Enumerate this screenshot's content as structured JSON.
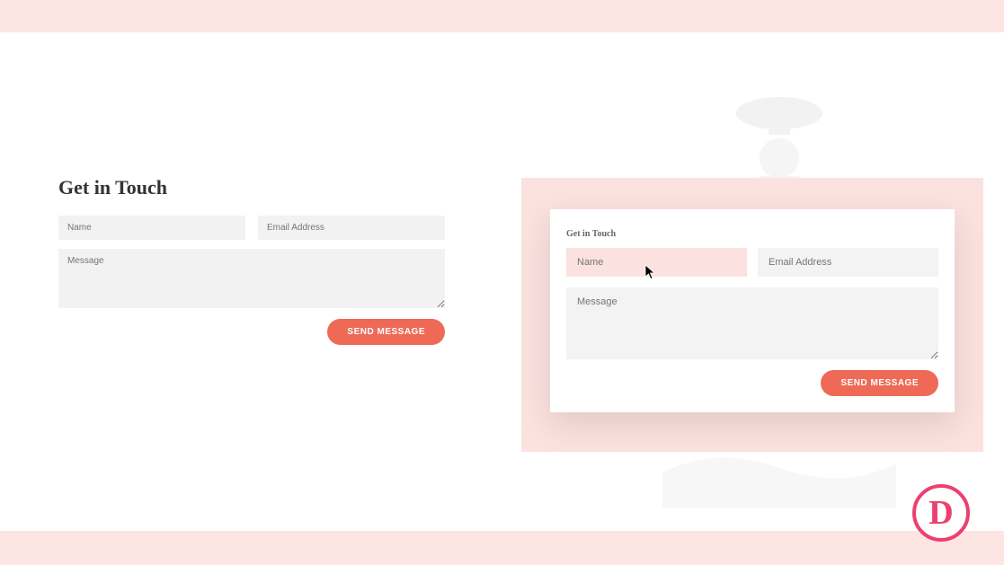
{
  "colors": {
    "accent": "#ee6a56",
    "pink_bg": "#fce2df",
    "logo": "#ee3f71"
  },
  "left_form": {
    "heading": "Get in Touch",
    "name_placeholder": "Name",
    "email_placeholder": "Email Address",
    "message_placeholder": "Message",
    "send_label": "SEND MESSAGE"
  },
  "right_form": {
    "heading": "Get in Touch",
    "name_placeholder": "Name",
    "email_placeholder": "Email Address",
    "message_placeholder": "Message",
    "send_label": "SEND MESSAGE"
  },
  "logo_letter": "D"
}
